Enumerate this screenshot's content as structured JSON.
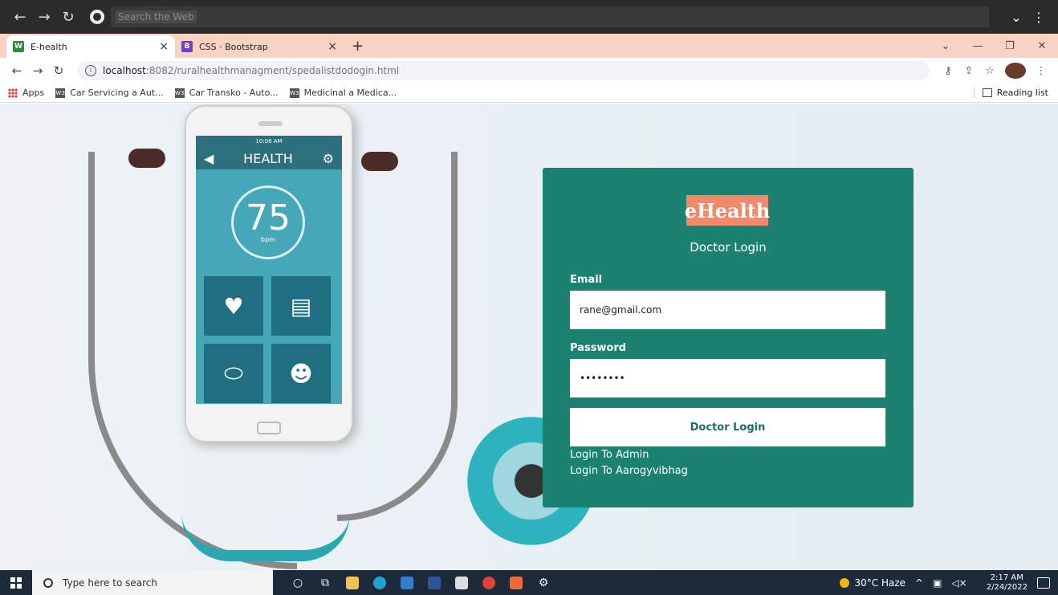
{
  "outer": {
    "search_text": "Search the Web"
  },
  "tabs": [
    {
      "favicon": "W",
      "title": "E-health",
      "active": true,
      "fav_color": "#2d8a3e"
    },
    {
      "favicon": "B",
      "title": "CSS · Bootstrap",
      "active": false,
      "fav_color": "#6f42c1"
    }
  ],
  "address": {
    "host": "localhost",
    "path": ":8082/ruralhealthmanagment/spedalistdodogin.html"
  },
  "bookmarks": {
    "apps": "Apps",
    "items": [
      "Car Servicing a Aut...",
      "Car Transko - Auto...",
      "Medicinal a Medica..."
    ],
    "reading_list": "Reading list"
  },
  "phone": {
    "time": "10:08 AM",
    "title": "HEALTH",
    "bpm_value": "75",
    "bpm_unit": "bpm"
  },
  "login": {
    "logo": "eHealth",
    "subtitle": "Doctor Login",
    "email_label": "Email",
    "email_value": "rane@gmail.com",
    "password_label": "Password",
    "password_value": "••••••••",
    "submit_label": "Doctor Login",
    "link_admin": "Login To Admin",
    "link_aarogya": "Login To Aarogyvibhag",
    "card_color": "#1b8171",
    "logo_color": "#f08a6a"
  },
  "taskbar": {
    "search_placeholder": "Type here to search",
    "weather": "30°C Haze",
    "time": "2:17 AM",
    "date": "2/24/2022"
  }
}
